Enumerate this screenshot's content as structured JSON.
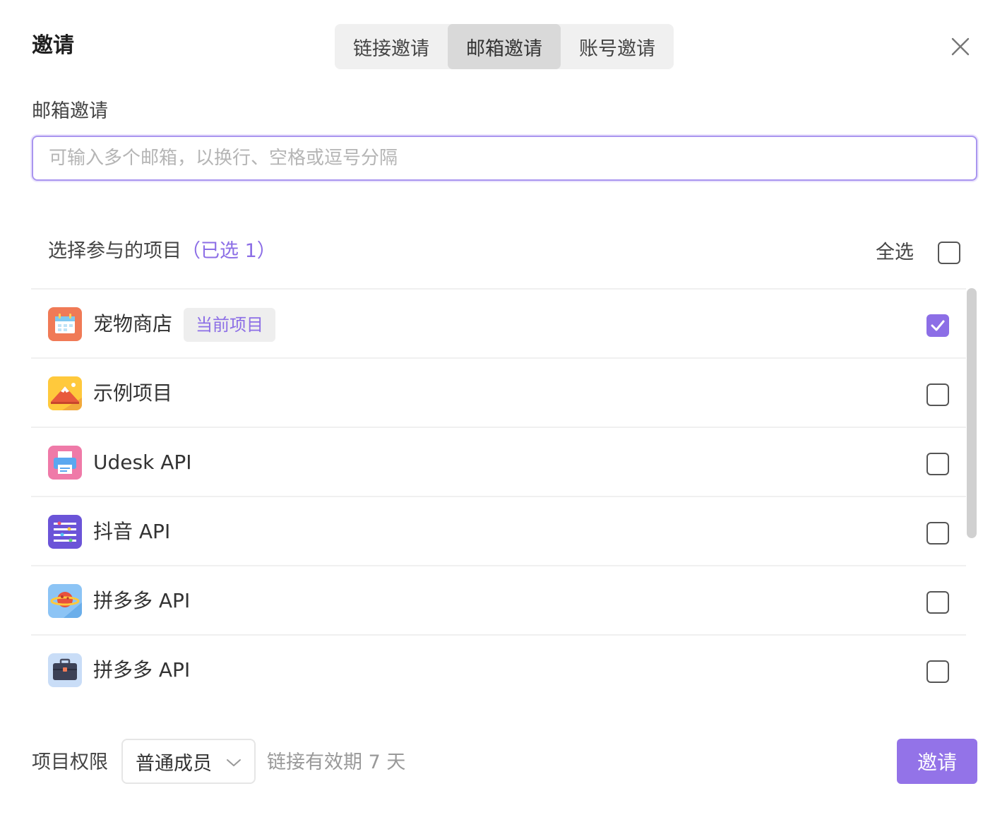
{
  "dialog": {
    "title": "邀请",
    "tabs": [
      {
        "label": "链接邀请",
        "active": false
      },
      {
        "label": "邮箱邀请",
        "active": true
      },
      {
        "label": "账号邀请",
        "active": false
      }
    ]
  },
  "email": {
    "label": "邮箱邀请",
    "value": "",
    "placeholder": "可输入多个邮箱，以换行、空格或逗号分隔"
  },
  "projects": {
    "heading": "选择参与的项目",
    "selected_text": "（已选 1）",
    "select_all_label": "全选",
    "select_all_checked": false,
    "items": [
      {
        "name": "宠物商店",
        "tag": "当前项目",
        "checked": true,
        "icon": "calendar-icon"
      },
      {
        "name": "示例项目",
        "tag": "",
        "checked": false,
        "icon": "mountain-icon"
      },
      {
        "name": "Udesk API",
        "tag": "",
        "checked": false,
        "icon": "printer-icon"
      },
      {
        "name": "抖音 API",
        "tag": "",
        "checked": false,
        "icon": "list-settings-icon"
      },
      {
        "name": "拼多多 API",
        "tag": "",
        "checked": false,
        "icon": "planet-icon"
      },
      {
        "name": "拼多多 API",
        "tag": "",
        "checked": false,
        "icon": "briefcase-icon"
      }
    ]
  },
  "footer": {
    "permission_label": "项目权限",
    "permission_value": "普通成员",
    "expire_text": "链接有效期 7 天",
    "invite_label": "邀请"
  },
  "colors": {
    "accent": "#9373e8",
    "accent_text": "#8c6ee6",
    "input_border": "#a995ef"
  }
}
